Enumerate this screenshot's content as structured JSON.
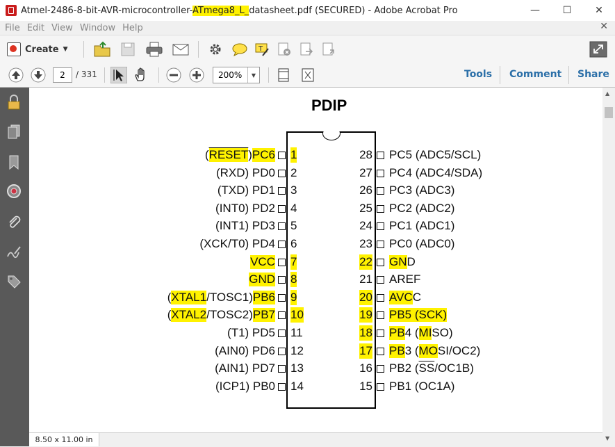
{
  "window": {
    "title_prefix": "Atmel-2486-8-bit-AVR-microcontroller-",
    "title_highlight": "ATmega8_L_",
    "title_suffix": "datasheet.pdf (SECURED) - Adobe Acrobat Pro",
    "minimize": "—",
    "maximize": "☐",
    "close": "✕"
  },
  "menu": [
    "File",
    "Edit",
    "View",
    "Window",
    "Help"
  ],
  "toolbar": {
    "create_label": "Create",
    "current_page": "2",
    "total_pages": "/ 331",
    "zoom": "200%",
    "tools_label": "Tools",
    "comment_label": "Comment",
    "share_label": "Share"
  },
  "status": {
    "page_size": "8.50 x 11.00 in"
  },
  "document": {
    "package_title": "PDIP",
    "left_pins": [
      {
        "num": "1",
        "label": [
          {
            "t": "(",
            "h": false
          },
          {
            "t": "RESET",
            "h": true,
            "o": true
          },
          {
            "t": ") ",
            "h": false
          },
          {
            "t": "PC6",
            "h": true
          }
        ],
        "num_hl": true
      },
      {
        "num": "2",
        "label": [
          {
            "t": "(RXD) PD0",
            "h": false
          }
        ],
        "num_hl": false
      },
      {
        "num": "3",
        "label": [
          {
            "t": "(TXD) PD1",
            "h": false
          }
        ],
        "num_hl": false
      },
      {
        "num": "4",
        "label": [
          {
            "t": "(INT0) PD2",
            "h": false
          }
        ],
        "num_hl": false
      },
      {
        "num": "5",
        "label": [
          {
            "t": "(INT1) PD3",
            "h": false
          }
        ],
        "num_hl": false
      },
      {
        "num": "6",
        "label": [
          {
            "t": "(XCK/T0) PD4",
            "h": false
          }
        ],
        "num_hl": false
      },
      {
        "num": "7",
        "label": [
          {
            "t": "VCC",
            "h": true
          }
        ],
        "num_hl": true
      },
      {
        "num": "8",
        "label": [
          {
            "t": "GND",
            "h": true
          }
        ],
        "num_hl": true
      },
      {
        "num": "9",
        "label": [
          {
            "t": "(",
            "h": false
          },
          {
            "t": "XTAL1",
            "h": true
          },
          {
            "t": "/TOSC1) ",
            "h": false
          },
          {
            "t": "PB6",
            "h": true
          }
        ],
        "num_hl": true
      },
      {
        "num": "10",
        "label": [
          {
            "t": "(",
            "h": false
          },
          {
            "t": "XTAL2",
            "h": true
          },
          {
            "t": "/TOSC2) ",
            "h": false
          },
          {
            "t": "PB7",
            "h": true
          }
        ],
        "num_hl": true
      },
      {
        "num": "11",
        "label": [
          {
            "t": "(T1) PD5",
            "h": false
          }
        ],
        "num_hl": false
      },
      {
        "num": "12",
        "label": [
          {
            "t": "(AIN0) PD6",
            "h": false
          }
        ],
        "num_hl": false
      },
      {
        "num": "13",
        "label": [
          {
            "t": "(AIN1) PD7",
            "h": false
          }
        ],
        "num_hl": false
      },
      {
        "num": "14",
        "label": [
          {
            "t": "(ICP1) PB0",
            "h": false
          }
        ],
        "num_hl": false
      }
    ],
    "right_pins": [
      {
        "num": "28",
        "label": [
          {
            "t": "PC5 (ADC5/SCL)",
            "h": false
          }
        ],
        "num_hl": false
      },
      {
        "num": "27",
        "label": [
          {
            "t": "PC4 (ADC4/SDA)",
            "h": false
          }
        ],
        "num_hl": false
      },
      {
        "num": "26",
        "label": [
          {
            "t": "PC3 (ADC3)",
            "h": false
          }
        ],
        "num_hl": false
      },
      {
        "num": "25",
        "label": [
          {
            "t": "PC2 (ADC2)",
            "h": false
          }
        ],
        "num_hl": false
      },
      {
        "num": "24",
        "label": [
          {
            "t": "PC1 (ADC1)",
            "h": false
          }
        ],
        "num_hl": false
      },
      {
        "num": "23",
        "label": [
          {
            "t": "PC0 (ADC0)",
            "h": false
          }
        ],
        "num_hl": false
      },
      {
        "num": "22",
        "label": [
          {
            "t": "GN",
            "h": true
          },
          {
            "t": "D",
            "h": false
          }
        ],
        "num_hl": true
      },
      {
        "num": "21",
        "label": [
          {
            "t": "AREF",
            "h": false
          }
        ],
        "num_hl": false
      },
      {
        "num": "20",
        "label": [
          {
            "t": "AVC",
            "h": true
          },
          {
            "t": "C",
            "h": false
          }
        ],
        "num_hl": true
      },
      {
        "num": "19",
        "label": [
          {
            "t": "PB5 (SCK)",
            "h": true
          }
        ],
        "num_hl": true
      },
      {
        "num": "18",
        "label": [
          {
            "t": "PB",
            "h": true
          },
          {
            "t": "4 (",
            "h": false
          },
          {
            "t": "MI",
            "h": true
          },
          {
            "t": "SO)",
            "h": false
          }
        ],
        "num_hl": true
      },
      {
        "num": "17",
        "label": [
          {
            "t": "PB",
            "h": true
          },
          {
            "t": "3 (",
            "h": false
          },
          {
            "t": "MO",
            "h": true
          },
          {
            "t": "SI/OC2)",
            "h": false
          }
        ],
        "num_hl": true
      },
      {
        "num": "16",
        "label": [
          {
            "t": "PB2 (",
            "h": false
          },
          {
            "t": "SS",
            "h": false,
            "o": true
          },
          {
            "t": "/OC1B)",
            "h": false
          }
        ],
        "num_hl": false
      },
      {
        "num": "15",
        "label": [
          {
            "t": "PB1 (OC1A)",
            "h": false
          }
        ],
        "num_hl": false
      }
    ]
  }
}
